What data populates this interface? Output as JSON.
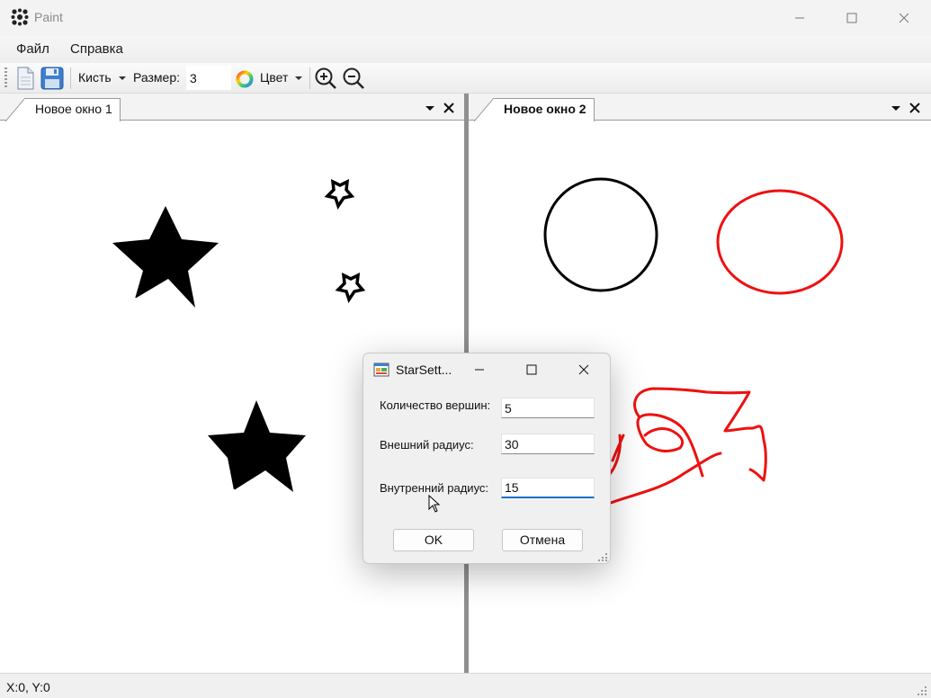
{
  "window": {
    "title": "Paint"
  },
  "menu": {
    "items": [
      "Файл",
      "Справка"
    ]
  },
  "toolbar": {
    "new_icon": "new-document-icon",
    "save_icon": "save-icon",
    "brush_label": "Кисть",
    "size_label": "Размер:",
    "size_value": "3",
    "color_label": "Цвет",
    "zoom_in_icon": "zoom-in-icon",
    "zoom_out_icon": "zoom-out-icon"
  },
  "panels": [
    {
      "tab_label": "Новое окно 1"
    },
    {
      "tab_label": "Новое окно 2"
    }
  ],
  "colors": {
    "stroke_black": "#000000",
    "stroke_red": "#ee1111",
    "focus_blue": "#1f6fc5"
  },
  "dialog": {
    "title": "StarSett...",
    "fields": [
      {
        "label": "Количество вершин:",
        "value": "5"
      },
      {
        "label": "Внешний радиус:",
        "value": "30"
      },
      {
        "label": "Внутренний радиус:",
        "value": "15"
      }
    ],
    "ok_label": "OK",
    "cancel_label": "Отмена"
  },
  "status": {
    "coords": "X:0, Y:0"
  }
}
